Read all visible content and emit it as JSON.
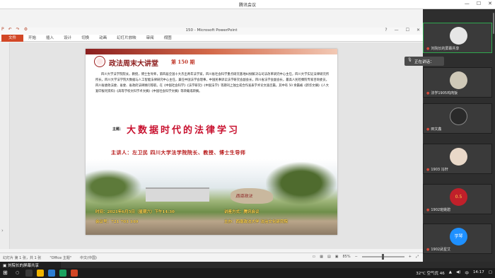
{
  "meeting": {
    "title": "腾讯会议",
    "win_min": "—",
    "win_max": "☐",
    "win_close": "✕"
  },
  "ppt": {
    "qat": [
      "P",
      "↶",
      "↷",
      "⚙"
    ],
    "title": "150 - Microsoft PowerPoint",
    "win": [
      "?",
      "—",
      "☐",
      "✕"
    ],
    "tabs": [
      "文件",
      "开始",
      "插入",
      "设计",
      "切换",
      "动画",
      "幻灯片放映",
      "审阅",
      "视图"
    ]
  },
  "slide": {
    "title": "政法周末大讲堂",
    "issue": "第 150 期",
    "bio": "四川大学法学院院长，教授，博士生导师，第四届全国十大杰出青年法学家，四川省社会科学重点研究基地纠纷解决与司法改革研究中心主任，四川大学实证法律研究所所长，四川大学法学院大数据与人工智能法律研究中心主任，兼任中国法学会理事，中国民事诉讼法学研究会副会长，四川省法学会副会长，最高人民检察院专家咨询委员，四川省委政法委、省委、省政府法律顾问等职。在《中国社会科学》《法学研究》《中国法学》等期刊上独立或合作发表学术论文逾百篇，其中有 50 余篇被《新华文摘》《人大复印报刊资料》《高等学校文科学术文摘》《中国社会科学文摘》等转载或转摘。",
    "topic_label": "主题：",
    "topic": "大数据时代的法律学习",
    "speaker": "主讲人：左卫民  四川大学法学院院长、教授、博士生导师",
    "rock_text": "西南政法",
    "time": "时间：2021年6月5日（星期六）下午14:30",
    "method": "讲座方式：腾讯会议",
    "meeting_no": "会议号：721 703 340",
    "host": "主办：西南政法大学 法治文化研究院"
  },
  "status": {
    "slide": "幻灯片 第 1 张，共 1 张",
    "theme": "\"Office 主题\"",
    "lang": "中文(中国)",
    "zoom": "85%"
  },
  "participants": [
    {
      "name": "刘院长的屏幕共享",
      "active": true,
      "avatar_text": "",
      "avatar_color": "#e6e6e6"
    },
    {
      "name": "法学1905鸡肉饭",
      "active": false,
      "avatar_text": "",
      "avatar_color": "#cfc9b8"
    },
    {
      "name": "田文鑫",
      "active": false,
      "avatar_text": "",
      "avatar_color": "#2a2a2a"
    },
    {
      "name": "1903 冯轩",
      "active": false,
      "avatar_text": "",
      "avatar_color": "#e9d8c8"
    },
    {
      "name": "1902班姚碧",
      "active": false,
      "avatar_text": "0.5",
      "avatar_color": "#c0202a"
    },
    {
      "name": "1902武星艾",
      "active": false,
      "avatar_text": "学琴",
      "avatar_color": "#1e90ff"
    }
  ],
  "speaking_label": "正在讲话：",
  "share_notice": "刘院长的屏幕共享",
  "taskbar": {
    "start": "⊞",
    "search": "○",
    "weather": "32°C 空气优 46",
    "ime": "中",
    "time": "14:17"
  }
}
